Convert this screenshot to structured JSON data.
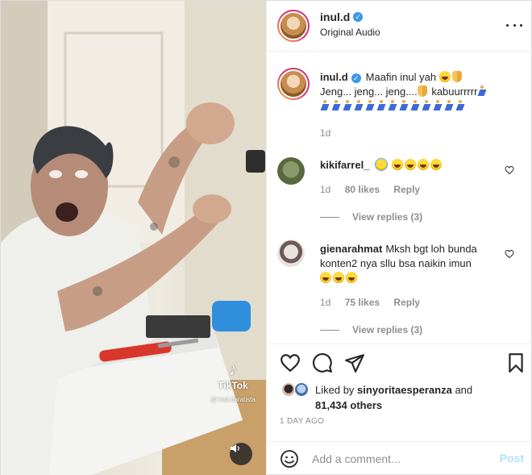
{
  "post": {
    "author": {
      "username": "inul.d",
      "subtitle": "Original Audio",
      "verified": true
    },
    "media": {
      "watermark_logo": "♪",
      "watermark_name": "TikTok",
      "watermark_user": "@ inul.daratista",
      "audio_icon": "speaker-icon"
    },
    "caption": {
      "username": "inul.d",
      "line1": "Maafin inul yah",
      "line2": "Jeng... jeng... jeng....",
      "line2b": "kabuurrrrr",
      "age": "1d"
    },
    "comments": [
      {
        "username": "kikifarrel_",
        "time": "1d",
        "likes": "80 likes",
        "reply": "Reply",
        "view_replies": "View replies (3)"
      },
      {
        "username": "gienarahmat",
        "text": "Mksh bgt loh bunda konten2 nya sllu bsa naikin imun",
        "time": "1d",
        "likes": "75 likes",
        "reply": "Reply",
        "view_replies": "View replies (3)"
      }
    ],
    "liked_by": {
      "prefix": "Liked by",
      "user": "sinyoritaesperanza",
      "and": "and",
      "others": "81,434 others"
    },
    "date": "1 DAY AGO",
    "add_comment": {
      "placeholder": "Add a comment...",
      "post_label": "Post"
    },
    "colors": {
      "verified": "#3897f0",
      "post_disabled": "#b2dffc",
      "muted": "#8e8e8e"
    }
  }
}
